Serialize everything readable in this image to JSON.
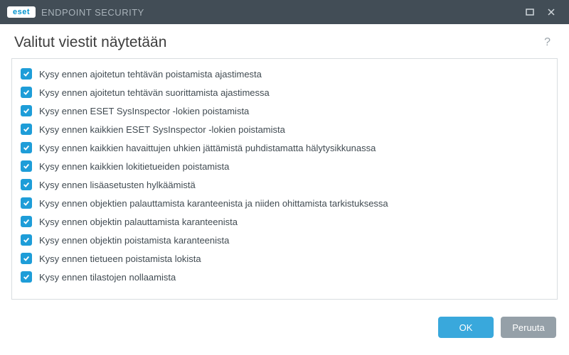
{
  "titlebar": {
    "brand_badge": "eset",
    "brand_text": "ENDPOINT SECURITY"
  },
  "heading": "Valitut viestit näytetään",
  "help_symbol": "?",
  "items": [
    {
      "checked": true,
      "label": "Kysy ennen ajoitetun tehtävän poistamista ajastimesta"
    },
    {
      "checked": true,
      "label": "Kysy ennen ajoitetun tehtävän suorittamista ajastimessa"
    },
    {
      "checked": true,
      "label": "Kysy ennen ESET SysInspector -lokien poistamista"
    },
    {
      "checked": true,
      "label": "Kysy ennen kaikkien ESET SysInspector -lokien poistamista"
    },
    {
      "checked": true,
      "label": "Kysy ennen kaikkien havaittujen uhkien jättämistä puhdistamatta hälytysikkunassa"
    },
    {
      "checked": true,
      "label": "Kysy ennen kaikkien lokitietueiden poistamista"
    },
    {
      "checked": true,
      "label": "Kysy ennen lisäasetusten hylkäämistä"
    },
    {
      "checked": true,
      "label": "Kysy ennen objektien palauttamista karanteenista ja niiden ohittamista tarkistuksessa"
    },
    {
      "checked": true,
      "label": "Kysy ennen objektin palauttamista karanteenista"
    },
    {
      "checked": true,
      "label": "Kysy ennen objektin poistamista karanteenista"
    },
    {
      "checked": true,
      "label": "Kysy ennen tietueen poistamista lokista"
    },
    {
      "checked": true,
      "label": "Kysy ennen tilastojen nollaamista"
    }
  ],
  "footer": {
    "ok": "OK",
    "cancel": "Peruuta"
  }
}
